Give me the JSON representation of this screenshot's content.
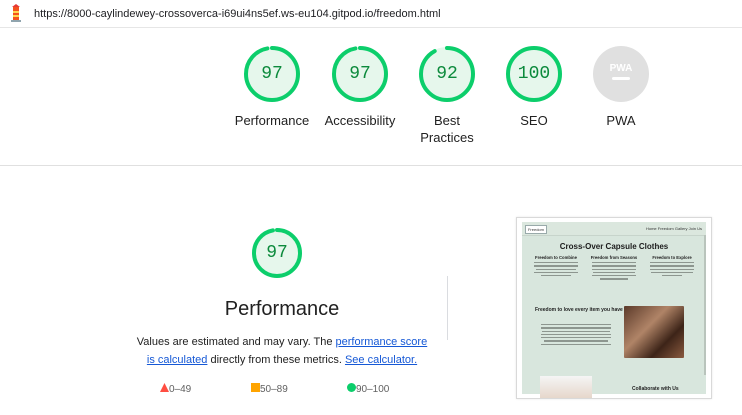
{
  "browser": {
    "url": "https://8000-caylindewey-crossoverca-i69ui4ns5ef.ws-eu104.gitpod.io/freedom.html"
  },
  "colors": {
    "pass_green": "#0cce6b",
    "pass_text": "#0c8a3c",
    "average_orange": "#ffa400",
    "fail_red": "#ff4e42",
    "pwa_gray": "#e0e0e0",
    "link_blue": "#1558d6"
  },
  "gauges": [
    {
      "score": "97",
      "label_line1": "Performance",
      "label_line2": "",
      "fraction": 0.97
    },
    {
      "score": "97",
      "label_line1": "Accessibility",
      "label_line2": "",
      "fraction": 0.97
    },
    {
      "score": "92",
      "label_line1": "Best",
      "label_line2": "Practices",
      "fraction": 0.92
    },
    {
      "score": "100",
      "label_line1": "SEO",
      "label_line2": "",
      "fraction": 1.0
    },
    {
      "score": "",
      "label_line1": "PWA",
      "label_line2": "",
      "badge": "PWA",
      "fraction": 0
    }
  ],
  "performance": {
    "score": "97",
    "fraction": 0.97,
    "title": "Performance",
    "desc_part1": "Values are estimated and may vary. The ",
    "link1": "performance score is calculated",
    "desc_part2": " directly from these metrics. ",
    "link2": "See calculator."
  },
  "legend": [
    {
      "icon": "fail-triangle-icon",
      "range": "0–49"
    },
    {
      "icon": "average-square-icon",
      "range": "50–89"
    },
    {
      "icon": "pass-circle-icon",
      "range": "90–100"
    }
  ],
  "thumbnail": {
    "brand": "Freedom",
    "nav_links": "Home  Freedom  Gallery  Join Us",
    "title": "Cross-Over Capsule Clothes",
    "columns": [
      "Freedom to Combine",
      "Freedom from Seasons",
      "Freedom to Explore"
    ],
    "section_heading": "Freedom to love every item you have",
    "collab_heading": "Collaborate with Us"
  }
}
